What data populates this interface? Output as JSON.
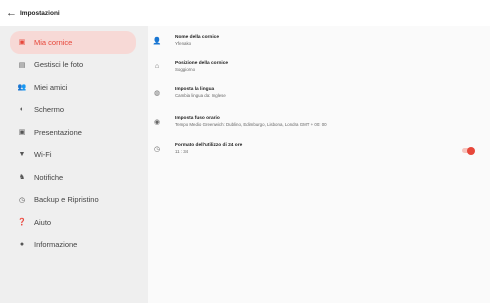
{
  "header": {
    "back_icon": "arrow-left-icon",
    "title": "Impostazioni"
  },
  "sidebar": {
    "items": [
      {
        "icon": "frame-icon",
        "label": "Mia cornice",
        "active": true
      },
      {
        "icon": "photos-icon",
        "label": "Gestisci le foto"
      },
      {
        "icon": "friends-icon",
        "label": "Miei amici"
      },
      {
        "icon": "screen-icon",
        "label": "Schermo"
      },
      {
        "icon": "presentation-icon",
        "label": "Presentazione"
      },
      {
        "icon": "wifi-icon",
        "label": "Wi-Fi"
      },
      {
        "icon": "bell-icon",
        "label": "Notifiche"
      },
      {
        "icon": "backup-icon",
        "label": "Backup e Ripristino"
      },
      {
        "icon": "help-icon",
        "label": "Aiuto"
      },
      {
        "icon": "info-icon",
        "label": "Informazione"
      }
    ]
  },
  "settings": {
    "name": {
      "title": "Nome della cornice",
      "value": "Yfenako"
    },
    "position": {
      "title": "Posizione della cornice",
      "value": "Soggiorno"
    },
    "language": {
      "title": "Imposta la lingua",
      "value": "Cambia lingua da: Inglese"
    },
    "timezone": {
      "title": "Imposta fuso orario",
      "value": "Tempo Medio Greenwich: Dublino, Edimburgo, Lisbona, Londra GMT + 00: 00"
    },
    "time_format": {
      "title": "Formato dell'utilizzo di 24 ore",
      "value": "11 : 34",
      "enabled": true
    }
  },
  "colors": {
    "accent": "#e7473a",
    "active_bg": "#f7d9d6",
    "sidebar_bg": "#efefef"
  }
}
